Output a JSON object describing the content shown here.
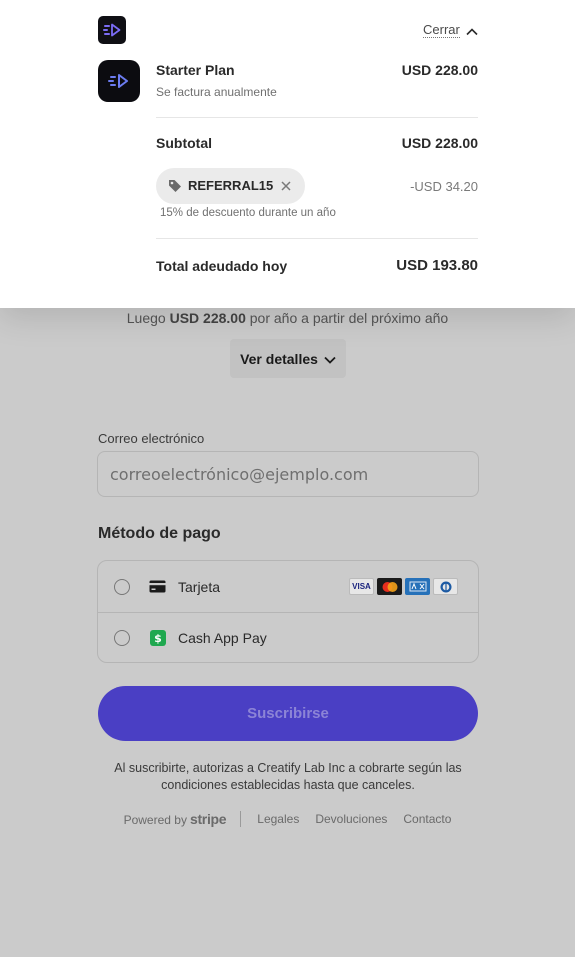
{
  "header": {
    "close_label": "Cerrar"
  },
  "plan": {
    "name": "Starter Plan",
    "billing": "Se factura anualmente",
    "price": "USD 228.00"
  },
  "summary": {
    "subtotal_label": "Subtotal",
    "subtotal_value": "USD 228.00",
    "promo_code": "REFERRAL15",
    "discount_value": "-USD 34.20",
    "discount_description": "15% de descuento durante un año",
    "total_label": "Total adeudado hoy",
    "total_value": "USD 193.80"
  },
  "renewal": {
    "prefix": "Luego",
    "amount": "USD 228.00",
    "suffix": "por año a partir del próximo año"
  },
  "details_button": "Ver detalles",
  "email": {
    "label": "Correo electrónico",
    "placeholder": "correoelectrónico@ejemplo.com"
  },
  "payment": {
    "title": "Método de pago",
    "options": [
      {
        "label": "Tarjeta",
        "selected": false
      },
      {
        "label": "Cash App Pay",
        "selected": false
      }
    ],
    "card_brands": [
      "VISA",
      "Mastercard",
      "American Express",
      "Diners Club"
    ]
  },
  "subscribe_button": "Suscribirse",
  "legal_text": "Al suscribirte, autorizas a Creatify Lab Inc a cobrarte según las condiciones establecidas hasta que canceles.",
  "footer": {
    "powered_by": "Powered by",
    "stripe": "stripe",
    "links": [
      "Legales",
      "Devoluciones",
      "Contacto"
    ]
  },
  "colors": {
    "accent": "#4a3fc4",
    "brand_purple": "#6c5ce7",
    "cash_app_green": "#1fa84f"
  }
}
